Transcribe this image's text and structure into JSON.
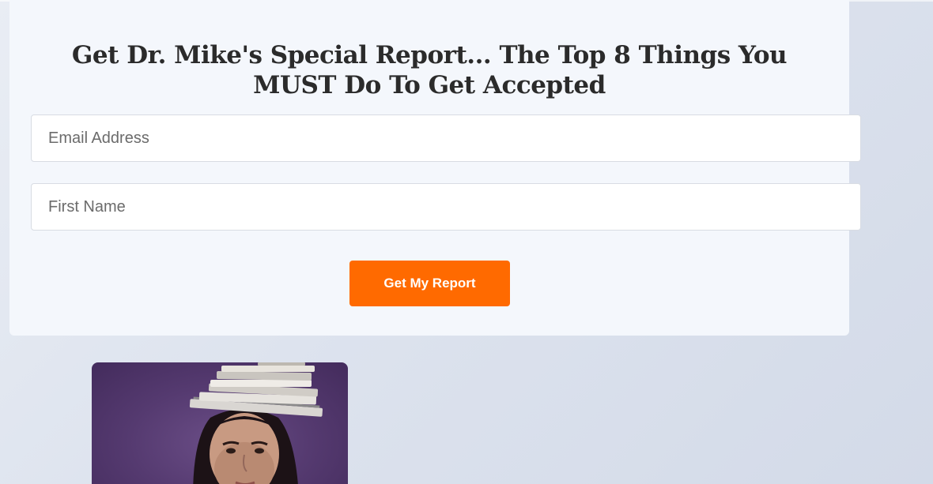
{
  "optin": {
    "headline": "Get Dr. Mike's Special Report... The Top 8 Things You MUST Do To Get Accepted",
    "email_placeholder": "Email Address",
    "first_name_placeholder": "First Name",
    "submit_label": "Get My Report",
    "accent_color": "#ff6a00"
  },
  "photo": {
    "subject": "student balancing stack of books on head",
    "background_color": "#5a3f74"
  }
}
